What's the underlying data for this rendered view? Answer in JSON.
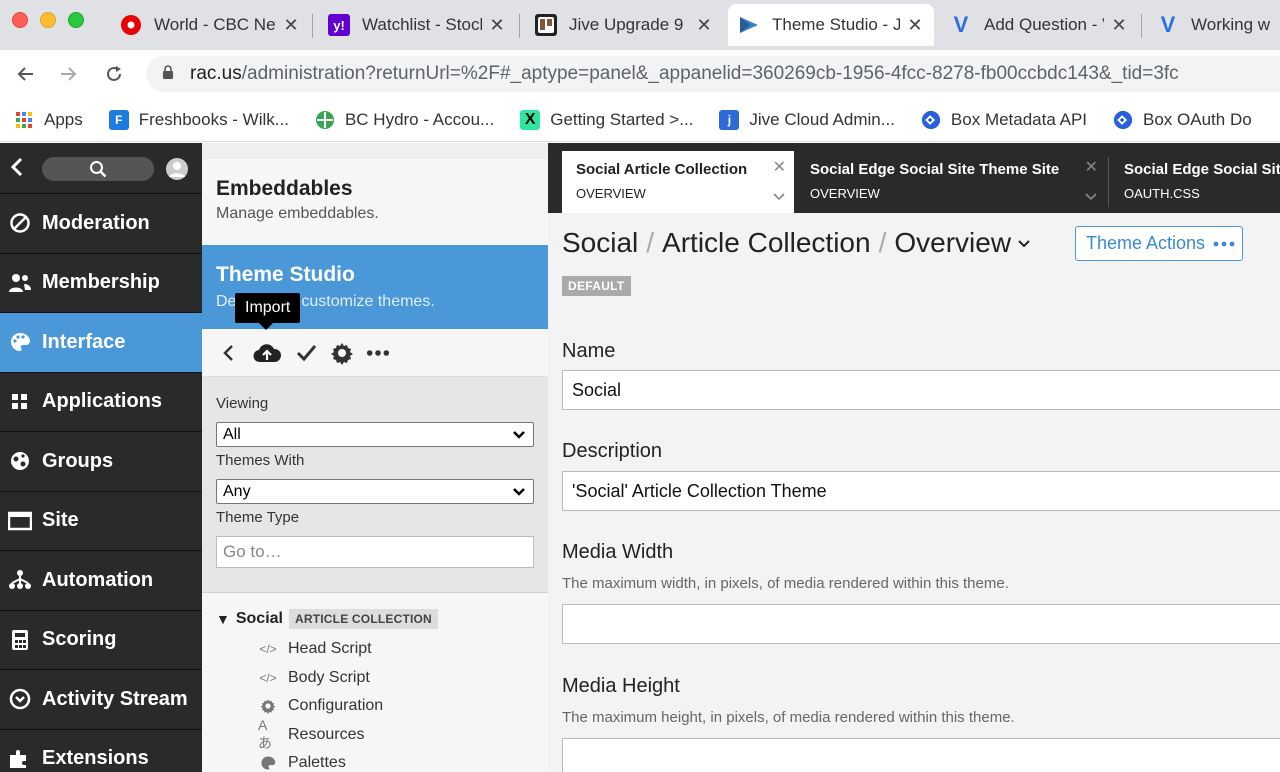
{
  "browser": {
    "tabs": [
      {
        "title": "World - CBC News",
        "favicon": "cbc-icon"
      },
      {
        "title": "Watchlist - Stocks",
        "favicon": "yahoo-icon"
      },
      {
        "title": "Jive Upgrade 9",
        "favicon": "trello-icon"
      },
      {
        "title": "Theme Studio - Jive",
        "favicon": "jive-theme-icon"
      },
      {
        "title": "Add Question - V",
        "favicon": "v-icon"
      },
      {
        "title": "Working with",
        "favicon": "v-icon"
      }
    ],
    "url_host": "rac.us",
    "url_path": "/administration?returnUrl=%2F#_aptype=panel&_appanelid=360269cb-1956-4fcc-8278-fb00ccbdc143&_tid=3fc",
    "bookmarks": [
      {
        "label": "Apps"
      },
      {
        "label": "Freshbooks - Wilk..."
      },
      {
        "label": "BC Hydro - Accou..."
      },
      {
        "label": "Getting Started >..."
      },
      {
        "label": "Jive Cloud Admin..."
      },
      {
        "label": "Box Metadata API"
      },
      {
        "label": "Box OAuth Do"
      }
    ]
  },
  "nav": {
    "items": [
      {
        "label": "Moderation",
        "icon": "ban-icon"
      },
      {
        "label": "Membership",
        "icon": "users-icon"
      },
      {
        "label": "Interface",
        "icon": "palette-icon"
      },
      {
        "label": "Applications",
        "icon": "grid-icon"
      },
      {
        "label": "Groups",
        "icon": "globe-icon"
      },
      {
        "label": "Site",
        "icon": "window-icon"
      },
      {
        "label": "Automation",
        "icon": "network-icon"
      },
      {
        "label": "Scoring",
        "icon": "calculator-icon"
      },
      {
        "label": "Activity Stream",
        "icon": "stream-icon"
      },
      {
        "label": "Extensions",
        "icon": "puzzle-icon"
      }
    ],
    "active": "Interface"
  },
  "middle": {
    "embeddables_title": "Embeddables",
    "embeddables_sub": "Manage embeddables.",
    "theme_studio_title": "Theme Studio",
    "theme_studio_sub": "Design and customize themes.",
    "tooltip": "Import",
    "viewing_label": "Viewing",
    "viewing_value": "All",
    "themes_with_label": "Themes With",
    "themes_with_value": "Any",
    "theme_type_label": "Theme Type",
    "goto_placeholder": "Go to…",
    "tree_root_name": "Social",
    "tree_root_badge": "ARTICLE COLLECTION",
    "tree_items": [
      {
        "label": "Head Script",
        "icon": "code-icon"
      },
      {
        "label": "Body Script",
        "icon": "code-icon"
      },
      {
        "label": "Configuration",
        "icon": "gear-icon"
      },
      {
        "label": "Resources",
        "icon": "translate-icon"
      },
      {
        "label": "Palettes",
        "icon": "palette-icon"
      }
    ]
  },
  "editor": {
    "tabs": [
      {
        "title": "Social Article Collection",
        "sub": "OVERVIEW"
      },
      {
        "title": "Social Edge Social Site Theme Site",
        "sub": "OVERVIEW"
      },
      {
        "title": "Social Edge Social Site",
        "sub": "OAUTH.CSS"
      }
    ],
    "crumb_1": "Social",
    "crumb_2": "Article Collection",
    "crumb_3": "Overview",
    "theme_actions": "Theme Actions",
    "default_badge": "DEFAULT",
    "name_label": "Name",
    "name_value": "Social",
    "desc_label": "Description",
    "desc_value": "'Social' Article Collection Theme",
    "mw_label": "Media Width",
    "mw_help": "The maximum width, in pixels, of media rendered within this theme.",
    "mh_label": "Media Height",
    "mh_help": "The maximum height, in pixels, of media rendered within this theme."
  }
}
